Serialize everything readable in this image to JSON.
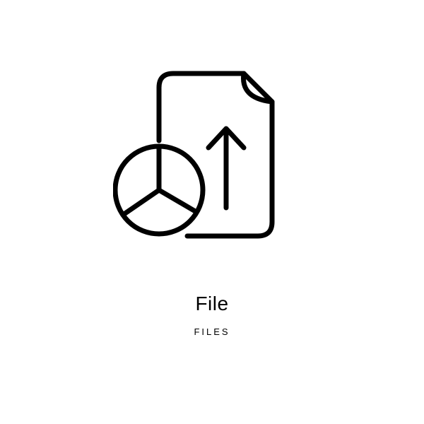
{
  "icon": {
    "name": "file-chart-arrow-icon",
    "stroke": "#000000"
  },
  "labels": {
    "title": "File",
    "subtitle": "FILES"
  }
}
